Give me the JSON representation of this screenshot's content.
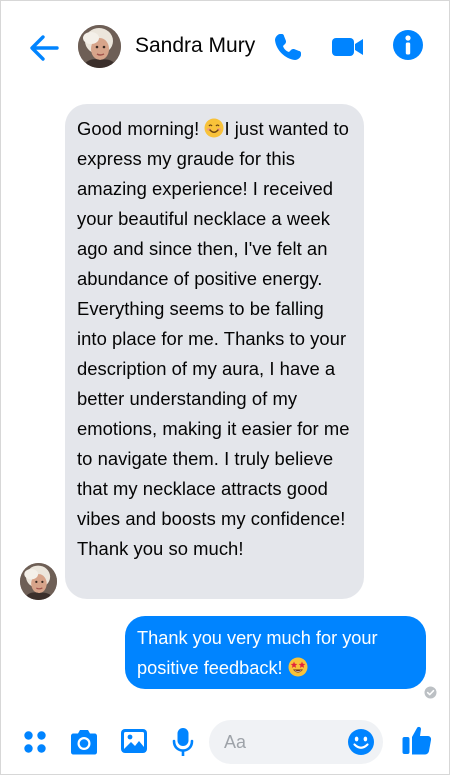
{
  "header": {
    "contact_name": "Sandra Mury",
    "back_icon": "arrow-left-icon",
    "call_icon": "phone-icon",
    "video_icon": "video-camera-icon",
    "info_icon": "info-icon",
    "accent_color": "#0084ff"
  },
  "messages": {
    "incoming": {
      "before_emoji": "Good morning! ",
      "emoji": "smiling-face-emoji",
      "after_emoji": "I just wanted to express my graude for this amazing experience! I received your beautiful necklace a week ago and since then, I've felt an abundance of positive energy. Everything seems to be falling into place for me. Thanks to your description of my aura, I have a better understanding of my emotions, making it easier for me to navigate them. I truly believe that my necklace attracts good vibes and boosts my confidence! Thank you so much!",
      "bubble_color": "#e4e6eb"
    },
    "outgoing": {
      "text": "Thank you very much for your positive feedback! ",
      "emoji": "star-struck-emoji",
      "bubble_color": "#0084ff"
    },
    "seen_indicator": "check-circle-icon"
  },
  "composer": {
    "placeholder": "Aa",
    "apps_icon": "four-dots-icon",
    "camera_icon": "camera-icon",
    "gallery_icon": "image-icon",
    "mic_icon": "microphone-icon",
    "emoji_icon": "smiley-icon",
    "like_icon": "thumbs-up-icon"
  }
}
